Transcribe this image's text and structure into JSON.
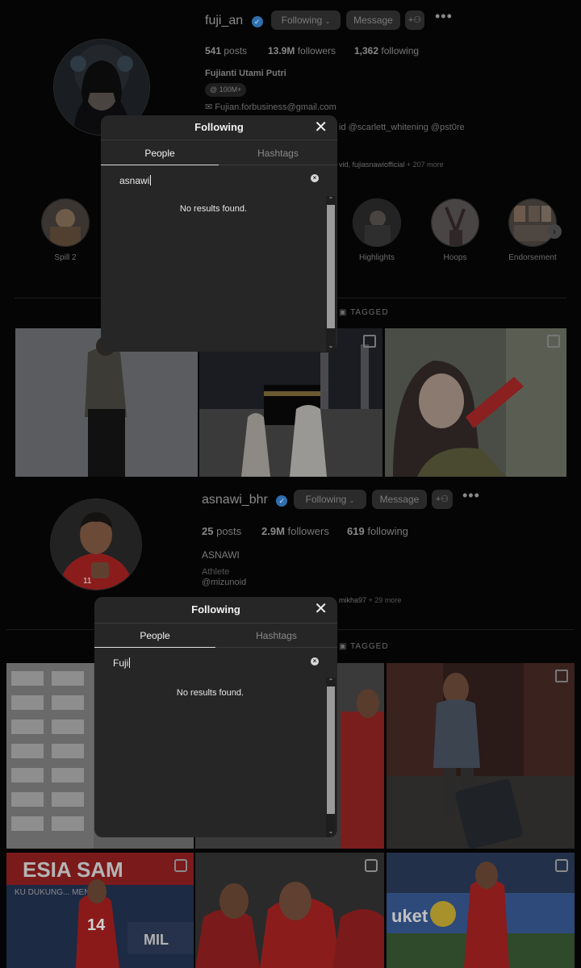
{
  "profile1": {
    "username": "fuji_an",
    "following_label": "Following",
    "message_label": "Message",
    "stats": {
      "posts": "541",
      "posts_label": "posts",
      "followers": "13.9M",
      "followers_label": "followers",
      "following": "1,362",
      "following_label": "following"
    },
    "full_name": "Fujianti Utami Putri",
    "threads_badge": "100M+",
    "email": "Fujian.forbusiness@gmail.com",
    "bio_tags": "id @scarlett_whitening @pst0re",
    "followed_by": "vid, fujiasnawiofficial",
    "followed_more": "+ 207 more",
    "highlights": [
      "Spill 2",
      "Highlights",
      "Hoops",
      "Endorsement"
    ],
    "tagged_label": "TAGGED"
  },
  "modal1": {
    "title": "Following",
    "tab_people": "People",
    "tab_hashtags": "Hashtags",
    "search_value": "asnawi",
    "empty_text": "No results found."
  },
  "profile2": {
    "username": "asnawi_bhr",
    "following_label": "Following",
    "message_label": "Message",
    "stats": {
      "posts": "25",
      "posts_label": "posts",
      "followers": "2.9M",
      "followers_label": "followers",
      "following": "619",
      "following_label": "following"
    },
    "full_name": "ASNAWI",
    "category": "Athlete",
    "mention": "@mizunoid",
    "followed_by": "mikha97",
    "followed_more": "+ 29 more",
    "tagged_label": "TAGGED",
    "jersey_number": "14",
    "banner_text": "ESIA SAM",
    "banner_sub": "KU DUKUNG... MEN",
    "sponsor_text": "uket",
    "mil_text": "MIL"
  },
  "modal2": {
    "title": "Following",
    "tab_people": "People",
    "tab_hashtags": "Hashtags",
    "search_value": "Fuji",
    "empty_text": "No results found."
  },
  "icons": {
    "close": "close-icon",
    "clear": "clear-search-icon",
    "verified": "verified-badge-icon",
    "more": "more-options-icon",
    "suggest": "add-person-icon"
  },
  "colors": {
    "verified_blue": "#2f6fae",
    "modal_bg": "#262626",
    "page_bg": "#000000"
  }
}
